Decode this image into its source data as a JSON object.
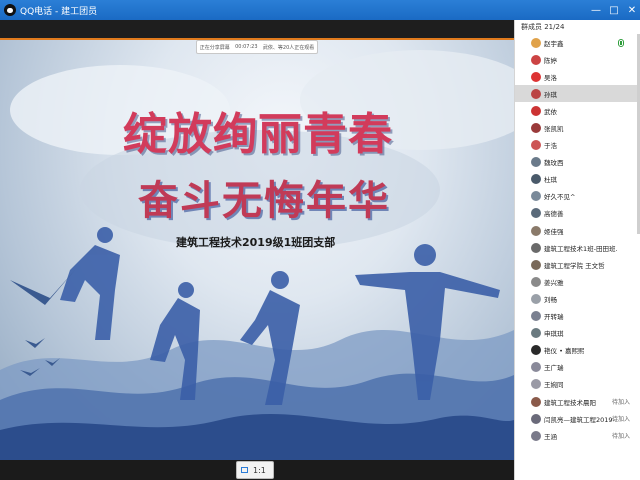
{
  "window": {
    "title": "QQ电话 - 建工团员"
  },
  "stage": {
    "notice_left": "正在分享屏幕",
    "notice_time": "00:07:23",
    "notice_right": "武依、等20人正在观看",
    "headline1": "绽放绚丽青春",
    "headline2": "奋斗无悔年华",
    "subtitle": "建筑工程技术2019级1班团支部",
    "zoom_label": "1:1"
  },
  "sidebar": {
    "header": "群成员 21/24",
    "members": [
      {
        "name": "赵宇鑫",
        "color": "#e0a24a",
        "status": "",
        "mic": true
      },
      {
        "name": "陈婷",
        "color": "#c44",
        "status": ""
      },
      {
        "name": "吴洛",
        "color": "#d33",
        "status": ""
      },
      {
        "name": "孙琪",
        "color": "#b44",
        "status": "",
        "selected": true
      },
      {
        "name": "武依",
        "color": "#c33",
        "status": ""
      },
      {
        "name": "张凯凯",
        "color": "#9a3a3a",
        "status": ""
      },
      {
        "name": "于浩",
        "color": "#c55",
        "status": ""
      },
      {
        "name": "魏玟西",
        "color": "#6a7a8a",
        "status": ""
      },
      {
        "name": "杜琪",
        "color": "#4a5a6a",
        "status": ""
      },
      {
        "name": "好久不见^",
        "color": "#7a8a9a",
        "status": ""
      },
      {
        "name": "高德善",
        "color": "#5a6a7a",
        "status": ""
      },
      {
        "name": "姬佳强",
        "color": "#8a7a6a",
        "status": ""
      },
      {
        "name": "建筑工程技术1班-田田班...",
        "color": "#6a6a6a",
        "status": ""
      },
      {
        "name": "建筑工程学院 王文哲",
        "color": "#7a6a5a",
        "status": ""
      },
      {
        "name": "姜兴雅",
        "color": "#8a8a8a",
        "status": ""
      },
      {
        "name": "刘畅",
        "color": "#9aa0a8",
        "status": ""
      },
      {
        "name": "开转瑞",
        "color": "#7a8090",
        "status": ""
      },
      {
        "name": "申琪琪",
        "color": "#6a7a80",
        "status": ""
      },
      {
        "name": "艳仪 • 嘉熙熙",
        "color": "#2a2a2a",
        "status": ""
      },
      {
        "name": "王广瑞",
        "color": "#8a8a9a",
        "status": ""
      },
      {
        "name": "王婉同",
        "color": "#9a9aa6",
        "status": ""
      },
      {
        "name": "建筑工程技术晨阳",
        "color": "#8a5a4a",
        "status": "待加入"
      },
      {
        "name": "闫凯亮—建筑工程2019-...",
        "color": "#6a6a7a",
        "status": "待加入"
      },
      {
        "name": "王涵",
        "color": "#7a7a8a",
        "status": "待加入"
      }
    ]
  },
  "icons": {
    "qq": "qq-logo-icon",
    "minimize": "minimize-icon",
    "maximize": "maximize-icon",
    "close": "close-icon",
    "mic": "microphone-icon",
    "screen": "screen-icon"
  }
}
